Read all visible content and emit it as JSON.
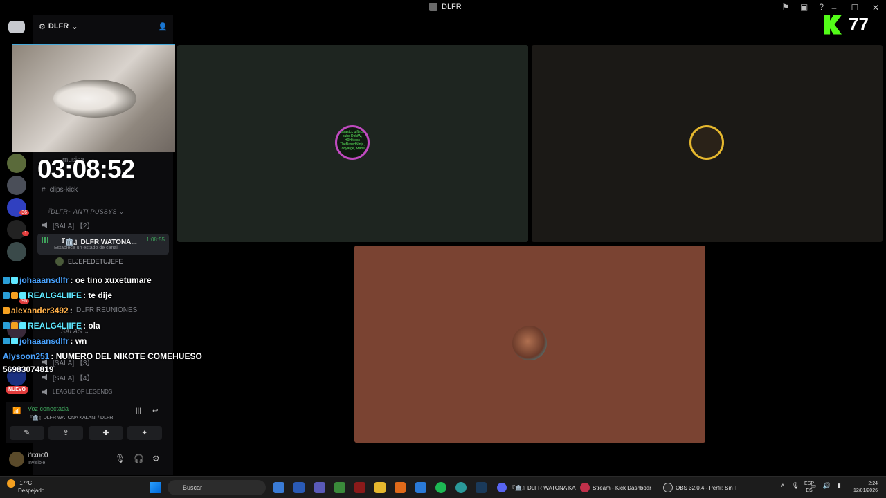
{
  "window": {
    "title": "DLFR"
  },
  "server": {
    "name": "DLFR"
  },
  "timer": "03:08:52",
  "channels": {
    "music": "musica",
    "clips": "clips-kick",
    "category1": "『DLFR~ ANTI PUSSYS ⌄",
    "sala2": "[SALA] 【2】",
    "active_name": "『🏛️』DLFR WATONA...",
    "active_time": "1:08:55",
    "active_sub": "Establece un estado de canal",
    "member1": "ELJEFEDETUJEFE",
    "reuniones": "DLFR REUNIONES",
    "category2": "SALAS ⌄",
    "sala3": "[SALA] 【3】",
    "sala4": "[SALA] 【4】",
    "lol": "LEAGUE OF LEGENDS"
  },
  "rail": {
    "badges": [
      "36",
      "1",
      "96"
    ],
    "nuevo": "NUEVO"
  },
  "chat": [
    {
      "user": "johaaansdlfr",
      "text": ": oe tino xuxetumare"
    },
    {
      "user": "REALG4LIIFE",
      "text": ": te dije"
    },
    {
      "user": "alexander3492",
      "text": ":"
    },
    {
      "user": "REALG4LIIFE",
      "text": ": ola"
    },
    {
      "user": "johaaansdlfr",
      "text": ": wn"
    },
    {
      "user": "Alysoon251",
      "text": ": NUMERO DEL NIKOTE COMEHUESO"
    },
    {
      "user": "",
      "text": "56983074819"
    }
  ],
  "voice": {
    "status": "Voz conectada",
    "channel": "『🏛️』DLFR WATONA KALANI / DLFR"
  },
  "user": {
    "name": "ifrxnc0",
    "status": "Invisible"
  },
  "tiles": {
    "t1_avatar_text": "contrastcc gifted 10 subs DokiW, H0HMess TheBasedNinja, Tonyarge, Mahe"
  },
  "kick": {
    "count": "77"
  },
  "taskbar": {
    "weather_temp": "17°C",
    "weather_desc": "Despejado",
    "search": "Buscar",
    "task_discord": "『🏛️』DLFR WATONA KA",
    "task_kick": "Stream - Kick Dashboar",
    "task_obs": "OBS 32.0.4 - Perfil: Sin T",
    "lang1": "ESP",
    "lang2": "ES",
    "time": "2:24",
    "date": "12/01/2026"
  },
  "colors": {
    "tile1": "#1e2520",
    "tile2": "#1b1916",
    "tile3": "#7a4332",
    "kick_green": "#53fc18",
    "voice_green": "#3fa55c"
  }
}
